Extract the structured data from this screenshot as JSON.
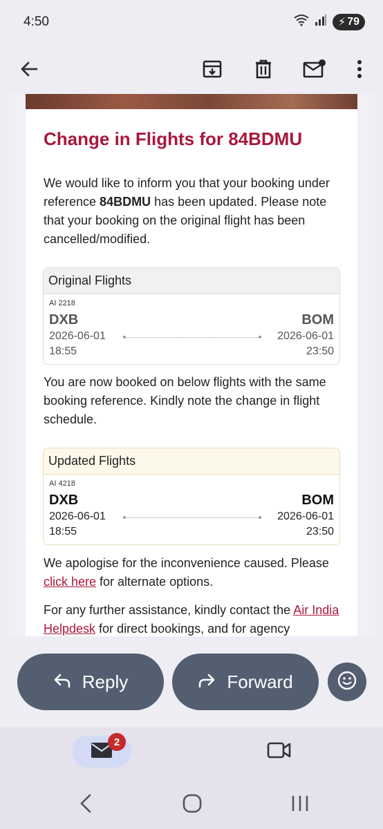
{
  "status_bar": {
    "time": "4:50",
    "battery": "79",
    "signal_label": "5"
  },
  "app_bar": {
    "icons": [
      "back-arrow-icon",
      "archive-icon",
      "delete-icon",
      "mark-unread-icon",
      "more-vert-icon"
    ]
  },
  "email": {
    "headline": "Change in Flights for 84BDMU",
    "intro_before": "We would like to inform you that your booking under reference ",
    "intro_ref": "84BDMU",
    "intro_after": " has been updated. Please note that your booking on the original flight has been cancelled/modified.",
    "original": {
      "header": "Original Flights",
      "flight_no": "AI 2218",
      "from_code": "DXB",
      "to_code": "BOM",
      "dep_date": "2026-06-01",
      "dep_time": "18:55",
      "arr_date": "2026-06-01",
      "arr_time": "23:50"
    },
    "rebooked_text": "You are now booked on below flights with the same booking reference. Kindly note the change in flight schedule.",
    "updated": {
      "header": "Updated Flights",
      "flight_no": "AI 4218",
      "from_code": "DXB",
      "to_code": "BOM",
      "dep_date": "2026-06-01",
      "dep_time": "18:55",
      "arr_date": "2026-06-01",
      "arr_time": "23:50"
    },
    "apology_before": "We apologise for the inconvenience caused. Please ",
    "apology_link": "click here",
    "apology_after": " for alternate options.",
    "assist_before": "For any further assistance, kindly contact the ",
    "assist_link": "Air India Helpdesk",
    "assist_after": " for direct bookings, and for agency"
  },
  "actions": {
    "reply_label": "Reply",
    "forward_label": "Forward"
  },
  "bottom_nav": {
    "mail_badge": "2"
  },
  "colors": {
    "accent": "#a8183c",
    "pill": "#545e71",
    "background": "#eeedf4"
  }
}
